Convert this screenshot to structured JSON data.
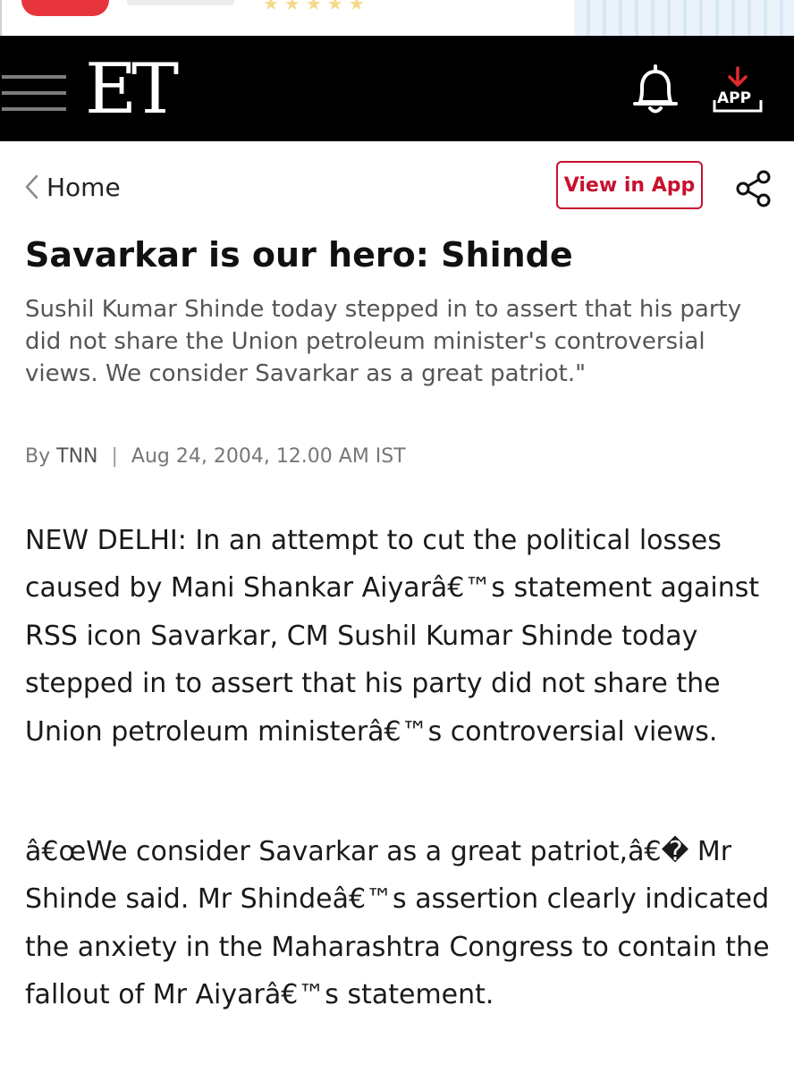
{
  "header": {
    "logo_text": "ET",
    "app_label": "APP",
    "bg_color": "#000000",
    "accent_color": "#c8102e"
  },
  "nav": {
    "back_label": "Home",
    "view_in_app_label": "View in App"
  },
  "article": {
    "title": "Savarkar is our hero: Shinde",
    "summary": "Sushil Kumar Shinde today stepped in to assert that his party did not share the Union petroleum minister's controversial views. We consider Savarkar as a great patriot.\"",
    "byline_prefix": "By",
    "author": "TNN",
    "separator": "|",
    "date": "Aug 24, 2004, 12.00 AM IST",
    "paragraphs": [
      "NEW DELHI: In an attempt to cut the political losses caused by Mani Shankar Aiyarâ€™s statement against RSS icon Savarkar, CM Sushil Kumar Shinde today stepped in to assert that his party did not share the Union petroleum ministerâ€™s controversial views.",
      "â€œWe consider Savarkar as a great patriot,â€� Mr Shinde said. Mr Shindeâ€™s assertion clearly indicated the anxiety in the Maharashtra Congress to contain the fallout of Mr Aiyarâ€™s statement."
    ]
  },
  "icons": {
    "menu": "hamburger-menu-icon",
    "notifications": "bell-icon",
    "download_app": "download-arrow-icon",
    "back": "chevron-left-icon",
    "share": "share-icon"
  }
}
